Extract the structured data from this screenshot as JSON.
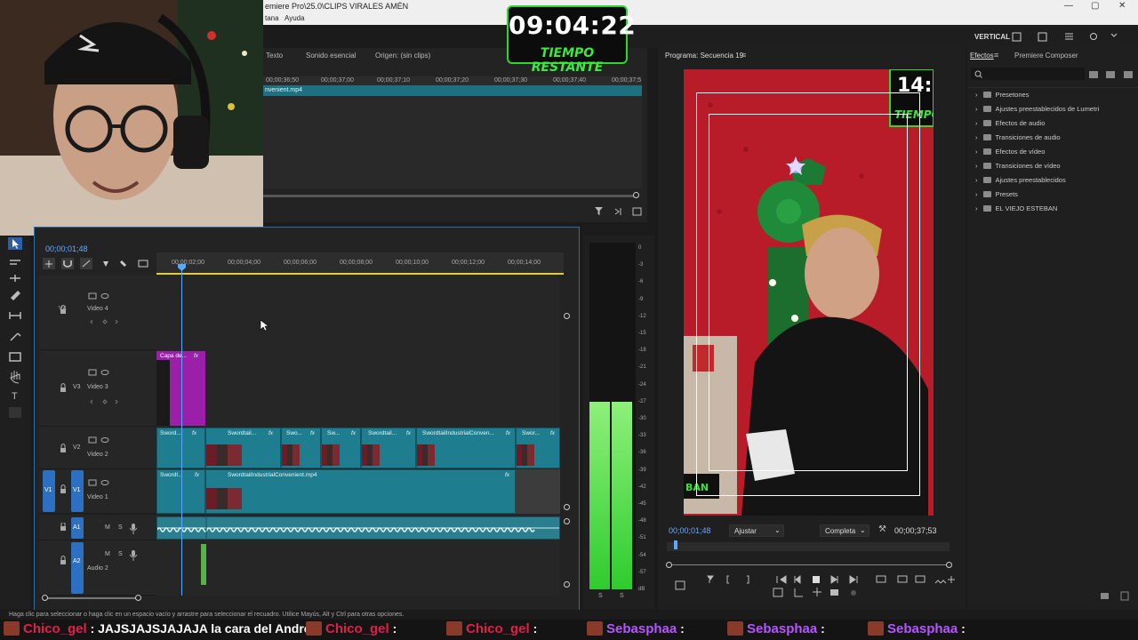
{
  "window": {
    "title": "emiere Pro\\25.0\\CLIPS VIRALES AMÉN",
    "controls": [
      "—",
      "▢",
      "✕"
    ]
  },
  "menubar": {
    "items": [
      "tana",
      "Ayuda"
    ]
  },
  "overlay": {
    "timer": "09:04:22",
    "timer_label": "TIEMPO RESTANTE"
  },
  "workspace": {
    "label": "VERTICAL"
  },
  "source_panel": {
    "tabs": [
      "Texto",
      "Sonido esencial",
      "Origen: (sin clips)"
    ],
    "ruler_ticks": [
      "00;00;36;50",
      "00;00;37;00",
      "00;00;37;10",
      "00;00;37;20",
      "00;00;37;30",
      "00;00;37;40",
      "00;00;37;5"
    ],
    "clip_name": "nvenient.mp4"
  },
  "timeline": {
    "timecode": "00;00;01;48",
    "ruler_ticks": [
      "00;00;02;00",
      "00;00;04;00",
      "00;00;06;00",
      "00;00;08;00",
      "00;00;10;00",
      "00;00;12;00",
      "00;00;14;00"
    ],
    "tracks": [
      {
        "id": "V4",
        "name": "Video 4"
      },
      {
        "id": "V3",
        "name": "Video 3"
      },
      {
        "id": "V2",
        "name": "Video 2"
      },
      {
        "id": "V1",
        "name": "Video 1",
        "source": "V1"
      },
      {
        "id": "A1",
        "name": "",
        "m": "M",
        "s": "S"
      },
      {
        "id": "A2",
        "name": "Audio 2",
        "m": "M",
        "s": "S"
      }
    ],
    "v3_clip": "Capa de...",
    "v2_clips": [
      "Sword...",
      "Swordtail...",
      "Swo...",
      "Sw...",
      "Swordtail...",
      "SwordtailIndustrialConven...",
      "Swor..."
    ],
    "v1_clips": [
      "Swordt...",
      "SwordtailIndustrialConvenient.mp4"
    ],
    "fx_label": "fx"
  },
  "meters": {
    "db_labels": [
      "0",
      "-3",
      "-6",
      "-9",
      "-12",
      "-15",
      "-18",
      "-21",
      "-24",
      "-27",
      "-30",
      "-33",
      "-36",
      "-39",
      "-42",
      "-45",
      "-48",
      "-51",
      "-54",
      "-57",
      "dB"
    ],
    "solo": [
      "S",
      "S"
    ],
    "level_left": 0.54,
    "level_right": 0.54
  },
  "program_panel": {
    "title": "Programa: Secuencia 19",
    "timecode": "00;00;01;48",
    "fit": "Ajustar",
    "quality": "Completa",
    "duration": "00;00;37;53",
    "overlay_time": "14:",
    "overlay_tiempo": "TIEMPO",
    "overlay_ban": "BAN"
  },
  "effects_panel": {
    "tabs": [
      "Efectos",
      "Premiere Composer"
    ],
    "items": [
      "Presetones",
      "Ajustes preestablecidos de Lumetri",
      "Efectos de audio",
      "Transiciones de audio",
      "Efectos de vídeo",
      "Transiciones de vídeo",
      "Ajustes preestablecidos",
      "Presets",
      "EL VIEJO ESTEBAN"
    ]
  },
  "status_bar": {
    "text": "Haga clic para seleccionar o haga clic en un espacio vacío y arrastre para seleccionar el recuadro. Utilice Mayús, Alt y Ctrl para otras opciones."
  },
  "chat": {
    "entries": [
      {
        "user": "Chico_gel",
        "message": "JAJSJAJSJAJAJA la cara del Andres"
      },
      {
        "user": "Chico_gel",
        "message": ""
      },
      {
        "user": "Chico_gel",
        "message": ""
      },
      {
        "user": "Sebasphaa",
        "message": ""
      },
      {
        "user": "Sebasphaa",
        "message": ""
      },
      {
        "user": "Sebasphaa",
        "message": ""
      }
    ],
    "colors": {
      "chico": "#e01f4a",
      "sebas": "#b455ff"
    }
  },
  "colors": {
    "accent_blue": "#2d8cff",
    "clip_teal": "#1e7d8f",
    "clip_purple": "#9b1fa8",
    "timer_green": "#2bd82b",
    "meter_green": "#3ee03e"
  }
}
